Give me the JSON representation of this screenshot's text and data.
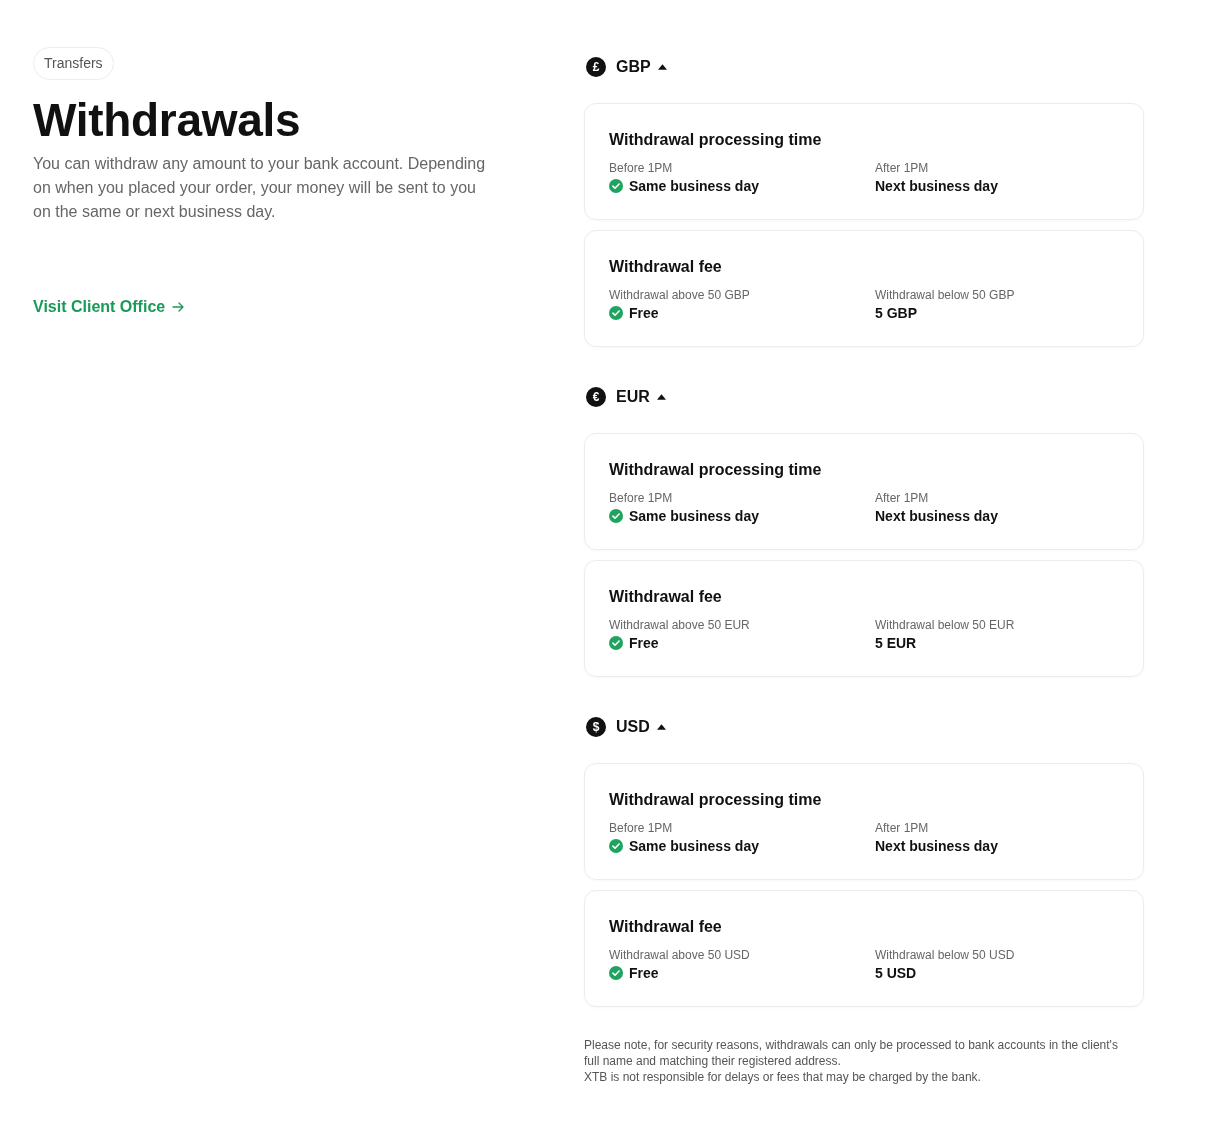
{
  "tag": "Transfers",
  "title": "Withdrawals",
  "description": "You can withdraw any amount to your bank account. Depending on when you placed your order, your money will be sent to you on the same or next business day.",
  "link": {
    "label": "Visit Client Office"
  },
  "currencies": [
    {
      "code": "GBP",
      "symbol": "£",
      "expanded": true,
      "cards": [
        {
          "title": "Withdrawal processing time",
          "columns": [
            {
              "label": "Before 1PM",
              "value": "Same business day",
              "checked": true
            },
            {
              "label": "After 1PM",
              "value": "Next business day",
              "checked": false
            }
          ]
        },
        {
          "title": "Withdrawal fee",
          "columns": [
            {
              "label": "Withdrawal above 50 GBP",
              "value": "Free",
              "checked": true
            },
            {
              "label": "Withdrawal below 50 GBP",
              "value": "5 GBP",
              "checked": false
            }
          ]
        }
      ]
    },
    {
      "code": "EUR",
      "symbol": "€",
      "expanded": true,
      "cards": [
        {
          "title": "Withdrawal processing time",
          "columns": [
            {
              "label": "Before 1PM",
              "value": "Same business day",
              "checked": true
            },
            {
              "label": "After 1PM",
              "value": "Next business day",
              "checked": false
            }
          ]
        },
        {
          "title": "Withdrawal fee",
          "columns": [
            {
              "label": "Withdrawal above 50 EUR",
              "value": "Free",
              "checked": true
            },
            {
              "label": "Withdrawal below 50 EUR",
              "value": "5 EUR",
              "checked": false
            }
          ]
        }
      ]
    },
    {
      "code": "USD",
      "symbol": "$",
      "expanded": true,
      "cards": [
        {
          "title": "Withdrawal processing time",
          "columns": [
            {
              "label": "Before 1PM",
              "value": "Same business day",
              "checked": true
            },
            {
              "label": "After 1PM",
              "value": "Next business day",
              "checked": false
            }
          ]
        },
        {
          "title": "Withdrawal fee",
          "columns": [
            {
              "label": "Withdrawal above 50 USD",
              "value": "Free",
              "checked": true
            },
            {
              "label": "Withdrawal below 50 USD",
              "value": "5 USD",
              "checked": false
            }
          ]
        }
      ]
    }
  ],
  "notes": [
    "Please note, for security reasons, withdrawals can only be processed to bank accounts in the client's full name and matching their registered address.",
    "XTB is not responsible for delays or fees that may be charged by the bank."
  ]
}
